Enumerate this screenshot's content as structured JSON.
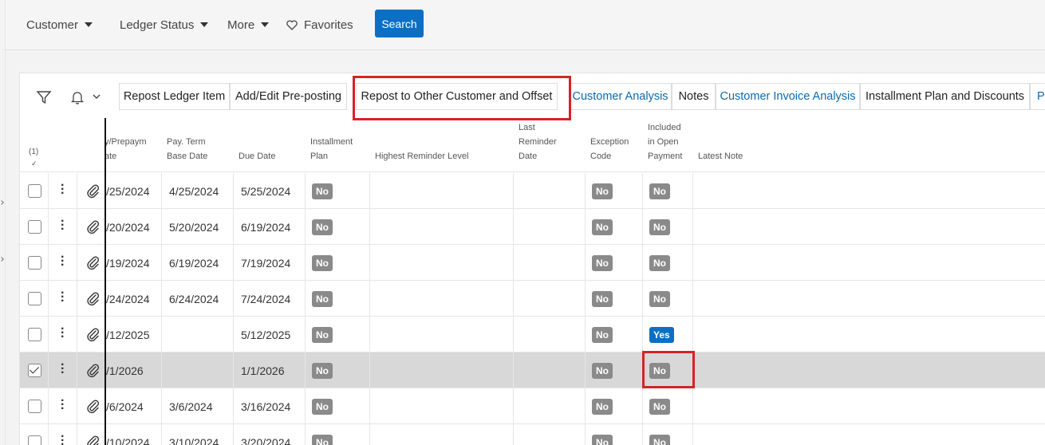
{
  "filters": {
    "customer": "Customer",
    "ledger_status": "Ledger Status",
    "more": "More",
    "favorites": "Favorites",
    "search": "Search"
  },
  "toolbar": {
    "buttons": [
      "Repost Ledger Item",
      "Add/Edit Pre-posting",
      "Repost to Other Customer and Offset",
      "Customer Analysis",
      "Notes",
      "Customer Invoice Analysis",
      "Installment Plan and Discounts",
      "Pa"
    ]
  },
  "grid": {
    "selection_count": "(1)",
    "selection_check": "✓",
    "headers": {
      "date": "y/Prepaym\nate",
      "pay_term_base_date": "Pay. Term\nBase Date",
      "due_date": "Due Date",
      "installment_plan": "Installment\nPlan",
      "highest_reminder_level": "Highest Reminder Level",
      "last_reminder_date": "Last\nReminder\nDate",
      "exception_code": "Exception\nCode",
      "included_in_open_payment": "Included\nin Open\nPayment",
      "latest_note": "Latest Note"
    },
    "rows": [
      {
        "date": "/25/2024",
        "base": "4/25/2024",
        "due": "5/25/2024",
        "inst": "No",
        "exc": "No",
        "incl": "No",
        "checked": false
      },
      {
        "date": "/20/2024",
        "base": "5/20/2024",
        "due": "6/19/2024",
        "inst": "No",
        "exc": "No",
        "incl": "No",
        "checked": false
      },
      {
        "date": "/19/2024",
        "base": "6/19/2024",
        "due": "7/19/2024",
        "inst": "No",
        "exc": "No",
        "incl": "No",
        "checked": false
      },
      {
        "date": "/24/2024",
        "base": "6/24/2024",
        "due": "7/24/2024",
        "inst": "No",
        "exc": "No",
        "incl": "No",
        "checked": false
      },
      {
        "date": "/12/2025",
        "base": "",
        "due": "5/12/2025",
        "inst": "No",
        "exc": "No",
        "incl": "Yes",
        "checked": false
      },
      {
        "date": "/1/2026",
        "base": "",
        "due": "1/1/2026",
        "inst": "No",
        "exc": "No",
        "incl": "No",
        "checked": true
      },
      {
        "date": "/6/2024",
        "base": "3/6/2024",
        "due": "3/16/2024",
        "inst": "No",
        "exc": "No",
        "incl": "No",
        "checked": false
      },
      {
        "date": "/10/2024",
        "base": "3/10/2024",
        "due": "3/20/2024",
        "inst": "No",
        "exc": "No",
        "incl": "No",
        "checked": false
      }
    ]
  },
  "colors": {
    "accent": "#0b6fc5",
    "link": "#0a6ab0",
    "highlight": "#d42424",
    "badge_no": "#8a8a8a",
    "selected_row": "#d8d8d8"
  }
}
